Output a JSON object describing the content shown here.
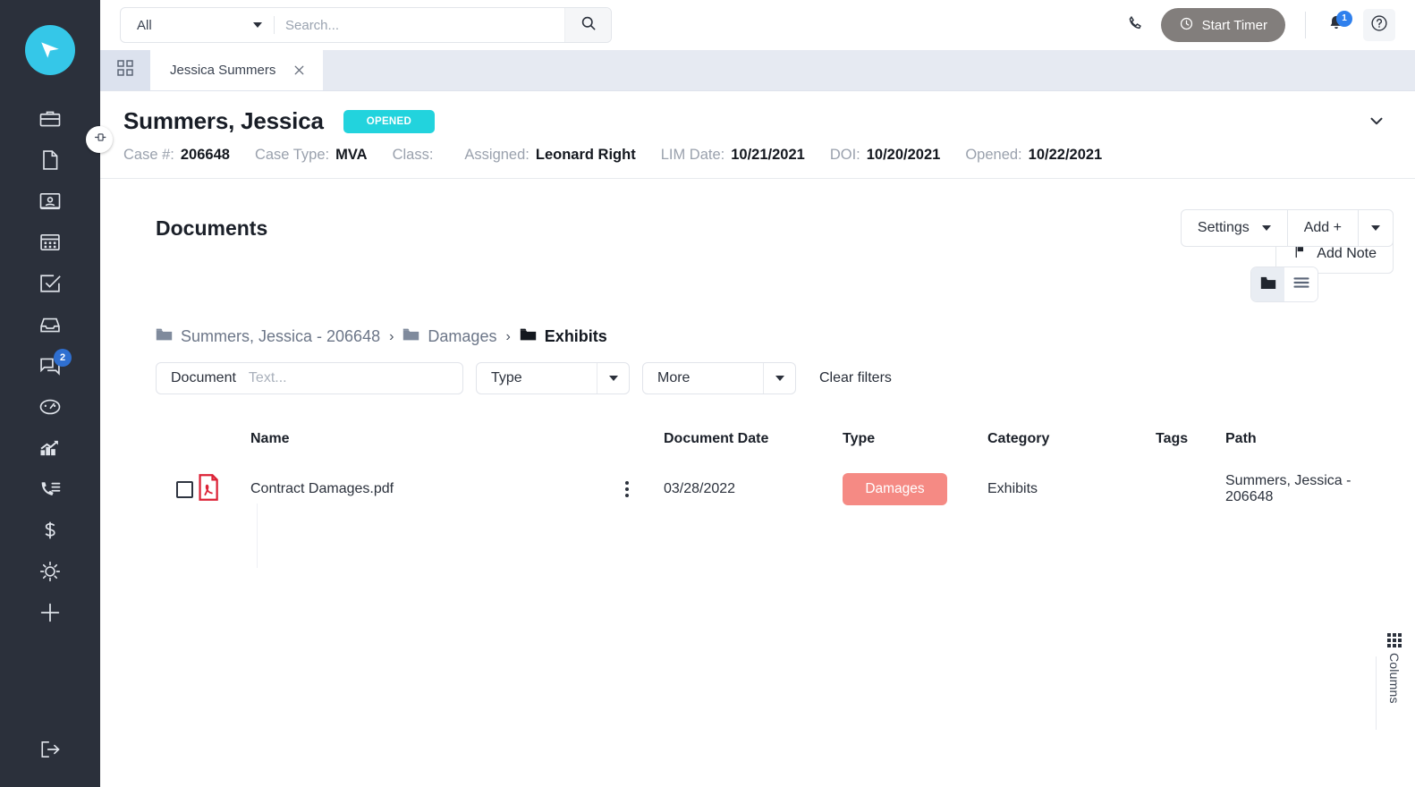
{
  "rail": {
    "logo": "play-logo",
    "items": [
      {
        "name": "briefcase-icon",
        "badge": null
      },
      {
        "name": "document-icon",
        "badge": null
      },
      {
        "name": "contact-card-icon",
        "badge": null
      },
      {
        "name": "calendar-icon",
        "badge": null
      },
      {
        "name": "tasks-check-icon",
        "badge": null
      },
      {
        "name": "inbox-icon",
        "badge": null
      },
      {
        "name": "messages-icon",
        "badge": "2"
      },
      {
        "name": "speedometer-icon",
        "badge": null
      },
      {
        "name": "reports-chart-icon",
        "badge": null
      },
      {
        "name": "call-list-icon",
        "badge": null
      },
      {
        "name": "dollar-icon",
        "badge": null
      },
      {
        "name": "settings-gear-icon",
        "badge": null
      },
      {
        "name": "add-plus-icon",
        "badge": null
      }
    ],
    "logout": "logout-icon",
    "pin_handle": "pin-icon"
  },
  "topbar": {
    "search_scope": "All",
    "search_placeholder": "Search...",
    "search_value": "",
    "search_icon": "search-icon",
    "phone_icon": "phone-icon",
    "timer_label": "Start Timer",
    "timer_icon": "clock-icon",
    "bell_icon": "bell-icon",
    "bell_badge": "1",
    "help_icon": "question-mark-icon"
  },
  "tabstrip": {
    "grid_icon": "grid-apps-icon",
    "tabs": [
      {
        "label": "Jessica Summers",
        "close_icon": "close-icon"
      }
    ]
  },
  "case_header": {
    "name": "Summers, Jessica",
    "status": "OPENED",
    "collapse_icon": "chevron-down-icon",
    "meta": [
      {
        "label": "Case #:",
        "value": "206648"
      },
      {
        "label": "Case Type:",
        "value": "MVA"
      },
      {
        "label": "Class:",
        "value": ""
      },
      {
        "label": "Assigned:",
        "value": "Leonard Right"
      },
      {
        "label": "LIM Date:",
        "value": "10/21/2021"
      },
      {
        "label": "DOI:",
        "value": "10/20/2021"
      },
      {
        "label": "Opened:",
        "value": "10/22/2021"
      }
    ],
    "add_note_label": "Add Note",
    "add_note_icon": "flag-icon"
  },
  "documents": {
    "title": "Documents",
    "settings_label": "Settings",
    "add_label": "Add +",
    "view_folder_icon": "folder-icon",
    "view_list_icon": "list-icon",
    "breadcrumb": [
      {
        "label": "Summers, Jessica - 206648",
        "active": false
      },
      {
        "label": "Damages",
        "active": false
      },
      {
        "label": "Exhibits",
        "active": true
      }
    ],
    "breadcrumb_separator": "›",
    "filters": {
      "document_label": "Document",
      "document_placeholder": "Text...",
      "document_value": "",
      "type_label": "Type",
      "more_label": "More",
      "clear_label": "Clear filters"
    },
    "columns": [
      "",
      "",
      "Name",
      "",
      "Document Date",
      "Type",
      "Category",
      "Tags",
      "Path"
    ],
    "headers": {
      "name": "Name",
      "document_date": "Document Date",
      "type": "Type",
      "category": "Category",
      "tags": "Tags",
      "path": "Path"
    },
    "rows": [
      {
        "checked": false,
        "file_icon": "pdf-file-icon",
        "name": "Contract Damages.pdf",
        "menu_icon": "kebab-menu-icon",
        "document_date": "03/28/2022",
        "type": "Damages",
        "category": "Exhibits",
        "tags": "",
        "path": "Summers, Jessica - 206648"
      }
    ],
    "columns_panel": {
      "label": "Columns",
      "icon": "grid-dots-icon"
    }
  },
  "colors": {
    "rail_bg": "#2b303b",
    "accent": "#35c7e8",
    "status_badge": "#22d3dd",
    "type_pill": "#f58a84",
    "badge_blue": "#2f80ed",
    "timer_bg": "#827e7c"
  }
}
